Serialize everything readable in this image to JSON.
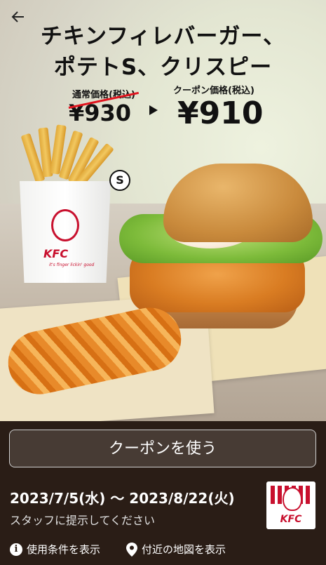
{
  "header": {
    "back_icon": "back-arrow-icon",
    "title_line1": "チキンフィレバーガー、",
    "title_line2": "ポテトS、クリスピー"
  },
  "pricing": {
    "regular_label": "通常価格(税込)",
    "regular_price": "¥930",
    "coupon_label": "クーポン価格(税込)",
    "coupon_price": "¥910"
  },
  "product": {
    "size_badge": "S",
    "fries_brand": "KFC",
    "fries_tagline": "it's finger lickin' good"
  },
  "coupon": {
    "use_button": "クーポンを使う",
    "period": "2023/7/5(水) 〜 2023/8/22(火)",
    "staff_note": "スタッフに提示してください",
    "logo_text": "KFC"
  },
  "footer": {
    "terms_link": "使用条件を表示",
    "map_link": "付近の地図を表示"
  },
  "colors": {
    "accent_red": "#e0141e",
    "kfc_red": "#c8102e",
    "bottom_bg": "#2a1d16"
  }
}
